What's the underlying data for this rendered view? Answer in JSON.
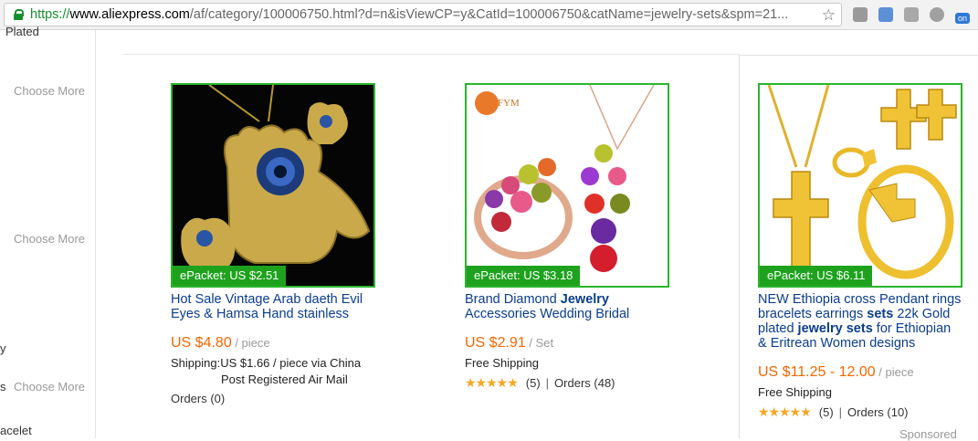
{
  "browser": {
    "url_scheme": "https://",
    "url_host": "www.aliexpress.com",
    "url_rest": "/af/category/100006750.html?d=n&isViewCP=y&CatId=100006750&catName=jewelry-sets&spm=21...",
    "star": "☆",
    "extension_on_label": "on"
  },
  "sidebar": {
    "items": [
      "Plated",
      "Choose More",
      "Choose More",
      "y",
      "s",
      "Choose More",
      "acelet"
    ]
  },
  "products": [
    {
      "epacket": "ePacket: US $2.51",
      "title": "Hot Sale Vintage Arab daeth Evil Eyes & Hamsa Hand stainless",
      "price": "US $4.80",
      "unit": " / piece",
      "shipping_1": "Shipping:US $1.66 / piece via China",
      "shipping_2": "Post Registered Air Mail",
      "orders": "Orders (0)"
    },
    {
      "epacket": "ePacket: US $3.18",
      "title_a": "Brand Diamond ",
      "title_b": "Jewelry",
      "title_c": " Accessories Wedding Bridal",
      "price": "US $2.91",
      "unit": " / Set",
      "shipping": "Free Shipping",
      "stars": "★★★★★",
      "reviews": "(5)",
      "orders": "Orders (48)",
      "brand": "FYM"
    },
    {
      "epacket": "ePacket: US $6.11",
      "title_a": "NEW Ethiopia cross Pendant rings bracelets earrings ",
      "title_b": "sets",
      "title_c": " 22k Gold plated ",
      "title_d": "jewelry sets",
      "title_e": " for Ethiopian & Eritrean Women designs",
      "price": "US $11.25 - 12.00",
      "unit": " / piece",
      "shipping": "Free Shipping",
      "stars": "★★★★★",
      "reviews": "(5)",
      "orders": "Orders (10)",
      "sponsored": "Sponsored"
    }
  ],
  "separator": "|"
}
